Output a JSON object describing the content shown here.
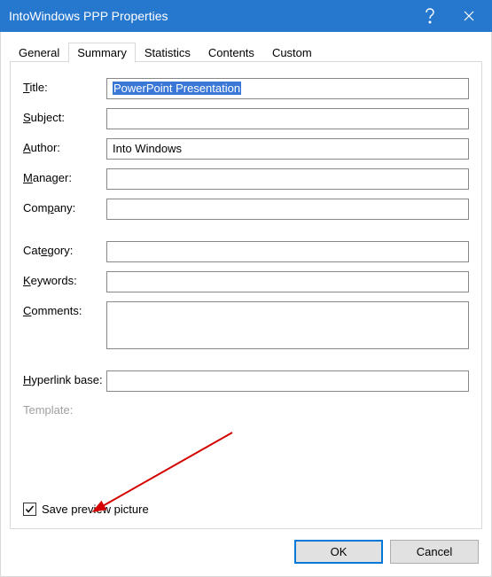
{
  "window": {
    "title": "IntoWindows PPP Properties"
  },
  "tabs": {
    "general": "General",
    "summary": "Summary",
    "statistics": "Statistics",
    "contents": "Contents",
    "custom": "Custom"
  },
  "fields": {
    "title_label_pre": "T",
    "title_label_post": "itle:",
    "title_value": "PowerPoint Presentation",
    "subject_label_pre": "S",
    "subject_label_post": "ubject:",
    "subject_value": "",
    "author_label_pre": "A",
    "author_label_post": "uthor:",
    "author_value": "Into Windows",
    "manager_label_pre": "M",
    "manager_label_post": "anager:",
    "manager_value": "",
    "company_label_pre": "Com",
    "company_label_u": "p",
    "company_label_post": "any:",
    "company_value": "",
    "category_label_pre": "Cat",
    "category_label_u": "e",
    "category_label_post": "gory:",
    "category_value": "",
    "keywords_label_pre": "K",
    "keywords_label_post": "eywords:",
    "keywords_value": "",
    "comments_label_pre": "C",
    "comments_label_post": "omments:",
    "comments_value": "",
    "hyperlink_label_pre": "H",
    "hyperlink_label_post": "yperlink base:",
    "hyperlink_value": "",
    "template_label": "Template:"
  },
  "checkbox": {
    "label_pre": "Sa",
    "label_u": "v",
    "label_post": "e preview picture",
    "checked": true
  },
  "buttons": {
    "ok": "OK",
    "cancel": "Cancel"
  }
}
